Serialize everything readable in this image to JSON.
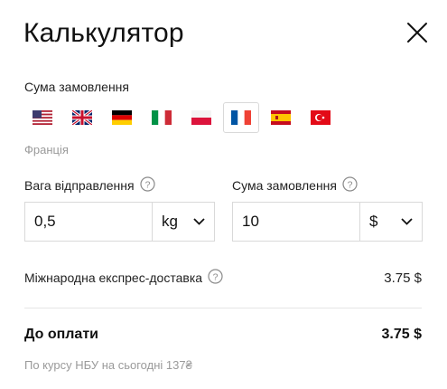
{
  "header": {
    "title": "Калькулятор",
    "close_icon": "close-icon"
  },
  "country_section": {
    "label": "Сума замовлення",
    "flags": [
      {
        "country": "usa",
        "icon": "usa-flag-icon"
      },
      {
        "country": "uk",
        "icon": "uk-flag-icon"
      },
      {
        "country": "germany",
        "icon": "germany-flag-icon"
      },
      {
        "country": "italy",
        "icon": "italy-flag-icon"
      },
      {
        "country": "poland",
        "icon": "poland-flag-icon"
      },
      {
        "country": "france",
        "icon": "france-flag-icon",
        "selected": true
      },
      {
        "country": "spain",
        "icon": "spain-flag-icon"
      },
      {
        "country": "turkey",
        "icon": "turkey-flag-icon"
      }
    ],
    "selected_country_name": "Франція"
  },
  "weight_field": {
    "label": "Вага відправлення",
    "value": "0,5",
    "unit": "kg"
  },
  "sum_field": {
    "label": "Сума замовлення",
    "value": "10",
    "unit": "$"
  },
  "express_delivery": {
    "label": "Міжнародна експрес-доставка",
    "price": "3.75 $"
  },
  "total": {
    "label": "До оплати",
    "price": "3.75 $"
  },
  "rate_note": "По курсу НБУ на сьогодні 137₴",
  "colors": {
    "text": "#1a1a1a",
    "muted": "#9a9a9a",
    "border": "#d9d9d9"
  }
}
